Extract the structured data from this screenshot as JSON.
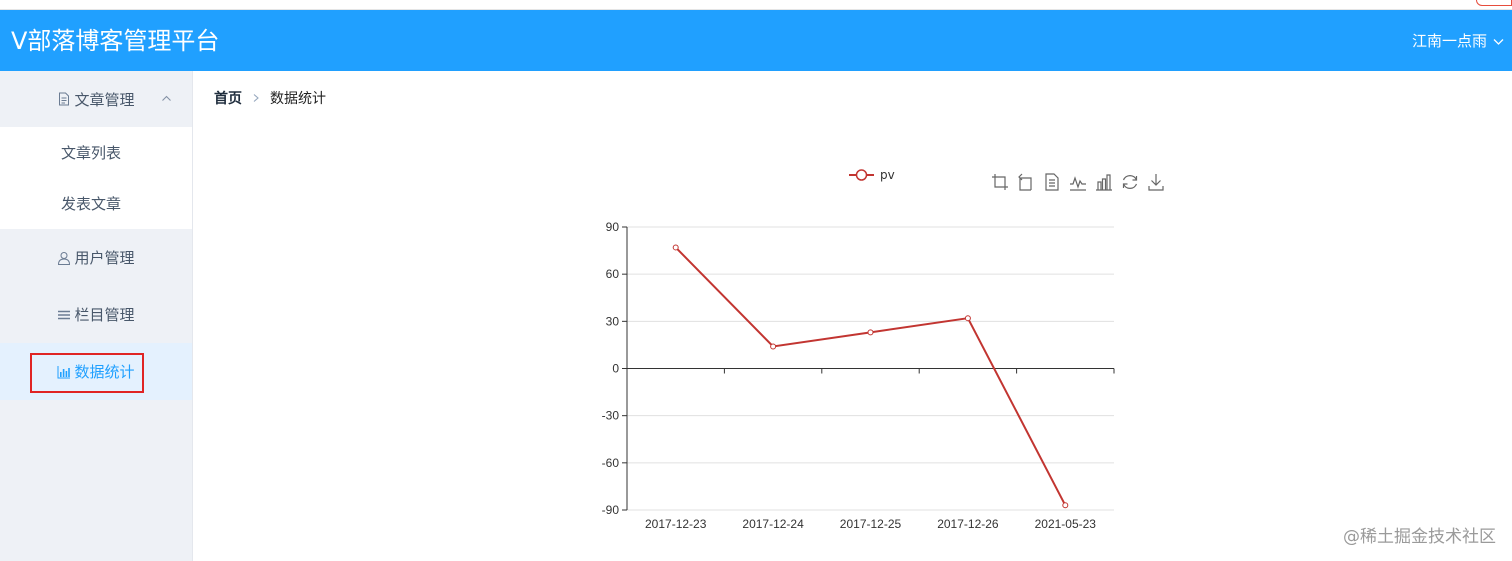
{
  "app": {
    "title": "V部落博客管理平台",
    "user_name": "江南一点雨",
    "header_color": "#20a0ff"
  },
  "sidebar": {
    "groups": [
      {
        "label": "文章管理",
        "icon": "document-icon",
        "expanded": true,
        "items": [
          {
            "label": "文章列表"
          },
          {
            "label": "发表文章"
          }
        ]
      },
      {
        "label": "用户管理",
        "icon": "user-icon"
      },
      {
        "label": "栏目管理",
        "icon": "menu-lines-icon"
      },
      {
        "label": "数据统计",
        "icon": "bar-chart-icon",
        "active": true
      }
    ],
    "active_color": "#20a0ff"
  },
  "breadcrumb": {
    "home": "首页",
    "current": "数据统计"
  },
  "chart_data": {
    "type": "line",
    "categories": [
      "2017-12-23",
      "2017-12-24",
      "2017-12-25",
      "2017-12-26",
      "2021-05-23"
    ],
    "series": [
      {
        "name": "pv",
        "values": [
          77,
          14,
          23,
          32,
          -87
        ],
        "color": "#c23531"
      }
    ],
    "ylim": [
      -90,
      90
    ],
    "yticks": [
      90,
      60,
      30,
      0,
      -30,
      -60,
      -90
    ],
    "grid": true,
    "legend_position": "top"
  },
  "toolbox": {
    "icons": [
      "zoom-icon",
      "zoom-reset-icon",
      "data-view-icon",
      "line-switch-icon",
      "bar-switch-icon",
      "restore-icon",
      "save-image-icon"
    ]
  },
  "watermark": "@稀土掘金技术社区"
}
